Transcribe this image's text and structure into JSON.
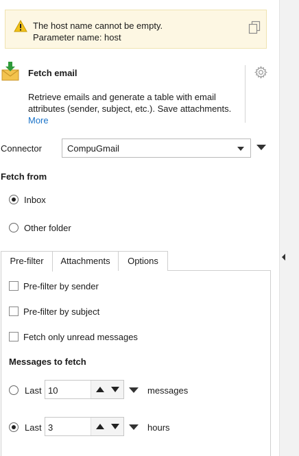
{
  "alert": {
    "line1": "The host name cannot be empty.",
    "line2": "Parameter name: host",
    "icon": "warning-icon",
    "copy_icon": "copy-icon",
    "color": "#fdf7e3"
  },
  "action": {
    "title": "Fetch email",
    "description_line1": "Retrieve emails and generate a table with email",
    "description_line2": "attributes (sender, subject, etc.). Save attachments.",
    "more_label": "More",
    "icon": "email-download-icon",
    "settings_icon": "gear-icon"
  },
  "connector": {
    "label": "Connector",
    "value": "CompuGmail"
  },
  "fetch_from": {
    "title": "Fetch from",
    "options": [
      {
        "label": "Inbox",
        "checked": true
      },
      {
        "label": "Other folder",
        "checked": false
      }
    ]
  },
  "tabs": [
    {
      "label": "Pre-filter",
      "active": true
    },
    {
      "label": "Attachments",
      "active": false
    },
    {
      "label": "Options",
      "active": false
    }
  ],
  "prefilter": {
    "checkboxes": [
      {
        "label": "Pre-filter by sender",
        "checked": false
      },
      {
        "label": "Pre-filter by subject",
        "checked": false
      },
      {
        "label": "Fetch only unread messages",
        "checked": false
      }
    ],
    "messages_title": "Messages to fetch",
    "rows": [
      {
        "radio_label": "Last",
        "value": "10",
        "unit": "messages",
        "checked": false
      },
      {
        "radio_label": "Last",
        "value": "3",
        "unit": "hours",
        "checked": true
      }
    ]
  },
  "colors": {
    "link": "#1a73c9",
    "alert_border": "#efe3b0"
  }
}
